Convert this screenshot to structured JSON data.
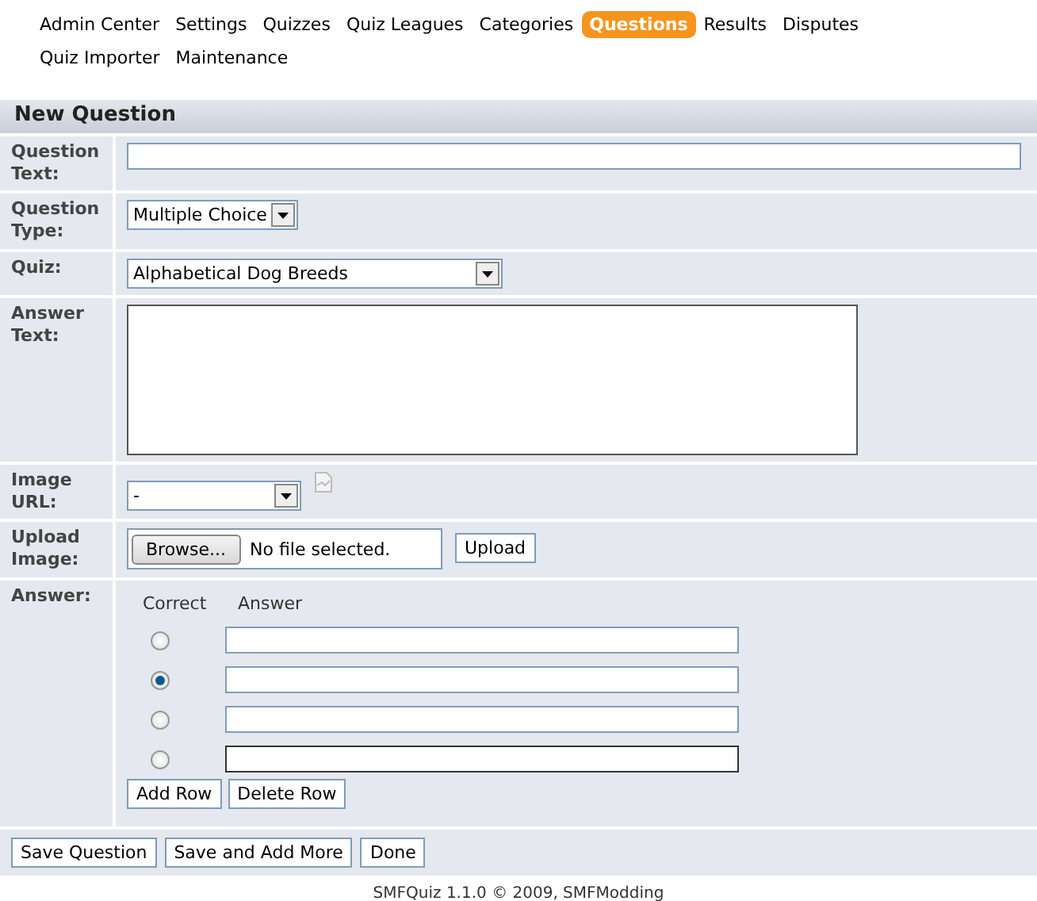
{
  "nav": [
    {
      "label": "Admin Center",
      "selected": false
    },
    {
      "label": "Settings",
      "selected": false
    },
    {
      "label": "Quizzes",
      "selected": false
    },
    {
      "label": "Quiz Leagues",
      "selected": false
    },
    {
      "label": "Categories",
      "selected": false
    },
    {
      "label": "Questions",
      "selected": true
    },
    {
      "label": "Results",
      "selected": false
    },
    {
      "label": "Disputes",
      "selected": false
    },
    {
      "label": "Quiz Importer",
      "selected": false
    },
    {
      "label": "Maintenance",
      "selected": false
    }
  ],
  "panel": {
    "title": "New Question",
    "fields": [
      {
        "kind": "text",
        "label": "Question Text:"
      },
      {
        "kind": "select",
        "label": "Question Type:",
        "value": "Multiple Choice"
      },
      {
        "kind": "select",
        "label": "Quiz:",
        "value": "Alphabetical Dog Breeds"
      },
      {
        "kind": "textarea",
        "label": "Answer Text:"
      },
      {
        "kind": "image",
        "label": "Image URL:",
        "value": "-"
      },
      {
        "kind": "upload",
        "label": "Upload Image:",
        "browse": "Browse...",
        "status": "No file selected.",
        "button": "Upload"
      },
      {
        "kind": "answers",
        "label": "Answer:",
        "headers": [
          "Correct",
          "Answer"
        ],
        "rows": [
          {
            "selected": false,
            "focused": false
          },
          {
            "selected": true,
            "focused": false
          },
          {
            "selected": false,
            "focused": false
          },
          {
            "selected": false,
            "focused": true
          }
        ],
        "buttons": [
          "Add Row",
          "Delete Row"
        ]
      }
    ]
  },
  "actions": [
    "Save Question",
    "Save and Add More",
    "Done"
  ],
  "footer": "SMFQuiz 1.1.0 © 2009, SMFModding"
}
